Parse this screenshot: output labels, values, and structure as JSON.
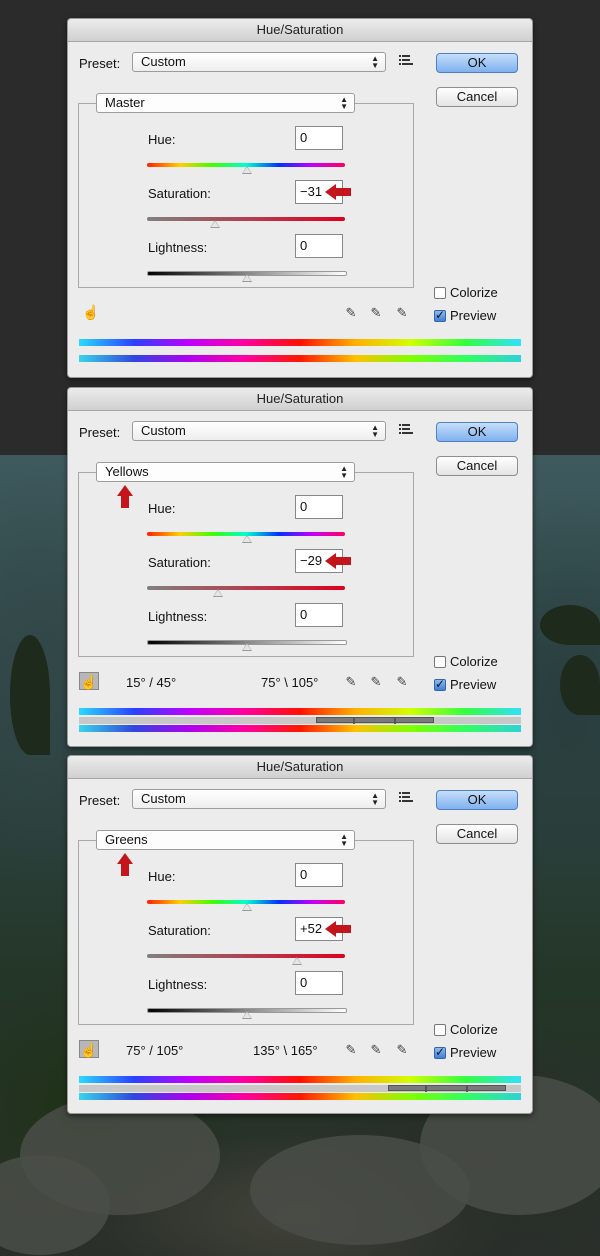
{
  "dialogs": [
    {
      "title": "Hue/Saturation",
      "preset_label": "Preset:",
      "preset_value": "Custom",
      "channel": "Master",
      "ok_label": "OK",
      "cancel_label": "Cancel",
      "hue_label": "Hue:",
      "hue_value": "0",
      "saturation_label": "Saturation:",
      "saturation_value": "−31",
      "lightness_label": "Lightness:",
      "lightness_value": "0",
      "colorize_label": "Colorize",
      "colorize_checked": false,
      "preview_label": "Preview",
      "preview_checked": true,
      "range_left": "",
      "range_right": ""
    },
    {
      "title": "Hue/Saturation",
      "preset_label": "Preset:",
      "preset_value": "Custom",
      "channel": "Yellows",
      "ok_label": "OK",
      "cancel_label": "Cancel",
      "hue_label": "Hue:",
      "hue_value": "0",
      "saturation_label": "Saturation:",
      "saturation_value": "−29",
      "lightness_label": "Lightness:",
      "lightness_value": "0",
      "colorize_label": "Colorize",
      "colorize_checked": false,
      "preview_label": "Preview",
      "preview_checked": true,
      "range_left": "15° / 45°",
      "range_right": "75° \\ 105°"
    },
    {
      "title": "Hue/Saturation",
      "preset_label": "Preset:",
      "preset_value": "Custom",
      "channel": "Greens",
      "ok_label": "OK",
      "cancel_label": "Cancel",
      "hue_label": "Hue:",
      "hue_value": "0",
      "saturation_label": "Saturation:",
      "saturation_value": "+52",
      "lightness_label": "Lightness:",
      "lightness_value": "0",
      "colorize_label": "Colorize",
      "colorize_checked": false,
      "preview_label": "Preview",
      "preview_checked": true,
      "range_left": "75° / 105°",
      "range_right": "135° \\ 165°"
    }
  ],
  "colors": {
    "arrow": "#c3161c",
    "ok_button": "#7fb1ef"
  },
  "icons": {
    "hand": "hand-adjust-icon",
    "eyedropper": "eyedropper-icon",
    "eyedropper_add": "eyedropper-plus-icon",
    "eyedropper_subtract": "eyedropper-minus-icon",
    "preset_options": "preset-options-icon"
  }
}
